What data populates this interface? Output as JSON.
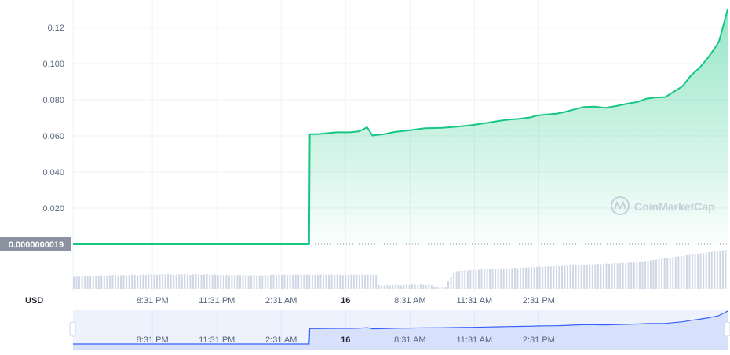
{
  "currency_label": "USD",
  "watermark": "CoinMarketCap",
  "current_price_label": "0.0000000019",
  "colors": {
    "line": "#16c784",
    "fill_top": "#16c784",
    "grid": "#eff2f5",
    "axis_text": "#58667e",
    "price_tag_bg": "#8a939f",
    "volume": "#cfd6e4",
    "navigator_bg": "#eef2fd",
    "navigator_line": "#3861fb"
  },
  "chart_data": {
    "type": "area",
    "title": "",
    "xlabel": "",
    "ylabel": "USD",
    "ylim": [
      0,
      0.13
    ],
    "y_ticks": [
      "0.020",
      "0.040",
      "0.060",
      "0.080",
      "0.100",
      "0.12"
    ],
    "y_tick_values": [
      0.02,
      0.04,
      0.06,
      0.08,
      0.1,
      0.12
    ],
    "x_range": [
      0,
      30.5
    ],
    "x_tick_labels": [
      "8:31 PM",
      "11:31 PM",
      "2:31 AM",
      "16",
      "8:31 AM",
      "11:31 AM",
      "2:31 PM"
    ],
    "x_tick_positions": [
      3.7,
      6.7,
      9.7,
      12.7,
      15.7,
      18.7,
      21.7
    ],
    "grid": true,
    "series": [
      {
        "x": [
          0,
          11.0,
          11.03,
          11.1,
          11.4,
          11.8,
          12.3,
          12.9,
          13.3,
          13.5,
          13.7,
          13.8,
          13.95,
          14.1,
          14.5,
          15.0,
          15.6,
          16.4,
          17.2,
          18.0,
          18.6,
          19.3,
          19.8,
          20.3,
          20.8,
          21.3,
          21.6,
          22.0,
          22.5,
          22.9,
          23.3,
          23.8,
          24.3,
          24.8,
          25.3,
          25.8,
          26.3,
          26.7,
          27.1,
          27.6,
          28.0,
          28.4,
          28.8,
          29.2,
          29.6,
          29.9,
          30.1,
          30.3,
          30.5
        ],
        "values": [
          1.9e-09,
          1.9e-09,
          0.061,
          0.061,
          0.061,
          0.0615,
          0.062,
          0.062,
          0.0625,
          0.0635,
          0.0648,
          0.063,
          0.0602,
          0.0605,
          0.061,
          0.0622,
          0.063,
          0.0642,
          0.0645,
          0.0652,
          0.066,
          0.0672,
          0.0682,
          0.069,
          0.0695,
          0.0702,
          0.0712,
          0.0718,
          0.0722,
          0.0732,
          0.0745,
          0.076,
          0.0762,
          0.0755,
          0.0765,
          0.0778,
          0.0788,
          0.0805,
          0.0812,
          0.0815,
          0.0845,
          0.0875,
          0.0935,
          0.0978,
          0.1035,
          0.1085,
          0.1125,
          0.121,
          0.13
        ]
      }
    ],
    "volume": [
      0.31,
      0.32,
      0.31,
      0.33,
      0.32,
      0.31,
      0.33,
      0.34,
      0.33,
      0.34,
      0.35,
      0.34,
      0.33,
      0.35,
      0.36,
      0.35,
      0.34,
      0.35,
      0.36,
      0.35,
      0.36,
      0.37,
      0.36,
      0.35,
      0.36,
      0.37,
      0.36,
      0.37,
      0.38,
      0.37,
      0.36,
      0.37,
      0.38,
      0.37,
      0.38,
      0.37,
      0.36,
      0.37,
      0.38,
      0.37,
      0.38,
      0.37,
      0.36,
      0.37,
      0.38,
      0.37,
      0.36,
      0.37,
      0.38,
      0.37,
      0.36,
      0.37,
      0.36,
      0.37,
      0.36,
      0.36,
      0.35,
      0.36,
      0.35,
      0.36,
      0.35,
      0.36,
      0.35,
      0.34,
      0.35,
      0.36,
      0.35,
      0.34,
      0.35,
      0.36,
      0.35,
      0.36,
      0.37,
      0.36,
      0.37,
      0.36,
      0.37,
      0.36,
      0.37,
      0.36,
      0.37,
      0.36,
      0.37,
      0.36,
      0.37,
      0.36,
      0.37,
      0.36,
      0.36,
      0.37,
      0.36,
      0.37,
      0.36,
      0.37,
      0.36,
      0.37,
      0.36,
      0.36,
      0.37,
      0.36,
      0.37,
      0.36,
      0.37,
      0.36,
      0.37,
      0.36,
      0.37,
      0.36,
      0.37,
      0.36,
      0.1,
      0.08,
      0.09,
      0.1,
      0.09,
      0.1,
      0.11,
      0.1,
      0.09,
      0.1,
      0.11,
      0.1,
      0.12,
      0.11,
      0.1,
      0.12,
      0.11,
      0.1,
      0.11,
      0.1,
      0.04,
      0.04,
      0.05,
      0.04,
      0.05,
      0.2,
      0.3,
      0.42,
      0.45,
      0.46,
      0.47,
      0.48,
      0.47,
      0.48,
      0.49,
      0.48,
      0.49,
      0.5,
      0.49,
      0.5,
      0.51,
      0.5,
      0.51,
      0.52,
      0.51,
      0.52,
      0.53,
      0.52,
      0.53,
      0.54,
      0.53,
      0.54,
      0.55,
      0.54,
      0.55,
      0.56,
      0.55,
      0.56,
      0.57,
      0.56,
      0.57,
      0.58,
      0.57,
      0.58,
      0.59,
      0.58,
      0.59,
      0.6,
      0.59,
      0.6,
      0.61,
      0.6,
      0.61,
      0.62,
      0.61,
      0.62,
      0.63,
      0.62,
      0.63,
      0.64,
      0.63,
      0.64,
      0.65,
      0.64,
      0.65,
      0.66,
      0.65,
      0.66,
      0.67,
      0.66,
      0.67,
      0.68,
      0.67,
      0.68,
      0.69,
      0.7,
      0.71,
      0.72,
      0.73,
      0.74,
      0.75,
      0.76,
      0.77,
      0.78,
      0.79,
      0.8,
      0.81,
      0.82,
      0.83,
      0.84,
      0.85,
      0.86,
      0.87,
      0.88,
      0.89,
      0.9,
      0.91,
      0.92,
      0.93,
      0.94,
      0.95,
      0.96,
      0.97,
      0.98,
      0.99,
      1.0
    ]
  }
}
